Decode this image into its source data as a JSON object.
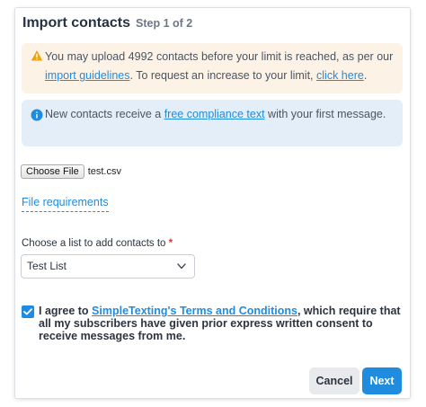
{
  "dialog": {
    "title": "Import contacts",
    "step": "Step 1 of 2"
  },
  "warning": {
    "icon": "warning-triangle-icon",
    "color": "#f0a30a",
    "text_1": "You may upload 4992 contacts before your limit is reached, as per our ",
    "link_1": "import guidelines",
    "text_2": ". To request an increase to your limit, ",
    "link_2": "click here",
    "text_3": "."
  },
  "info": {
    "icon": "info-circle-icon",
    "color": "#1f8ce0",
    "text_1": "New contacts receive a ",
    "link": "free compliance text",
    "text_2": " with your first message."
  },
  "file": {
    "button_label": "Choose File",
    "filename": "test.csv",
    "requirements_link": "File requirements"
  },
  "list_select": {
    "label": "Choose a list to add contacts to",
    "required_mark": "*",
    "value": "Test List"
  },
  "agreement": {
    "checked": true,
    "text_1": "I agree to ",
    "link": "SimpleTexting's Terms and Conditions",
    "text_2": ", which require that all my subscribers have given prior express written consent to receive messages from me."
  },
  "buttons": {
    "cancel": "Cancel",
    "next": "Next"
  },
  "colors": {
    "accent": "#1f8ce0",
    "warning_bg": "#fdf2e6",
    "info_bg": "#e4eef8",
    "required": "#e0342b"
  }
}
